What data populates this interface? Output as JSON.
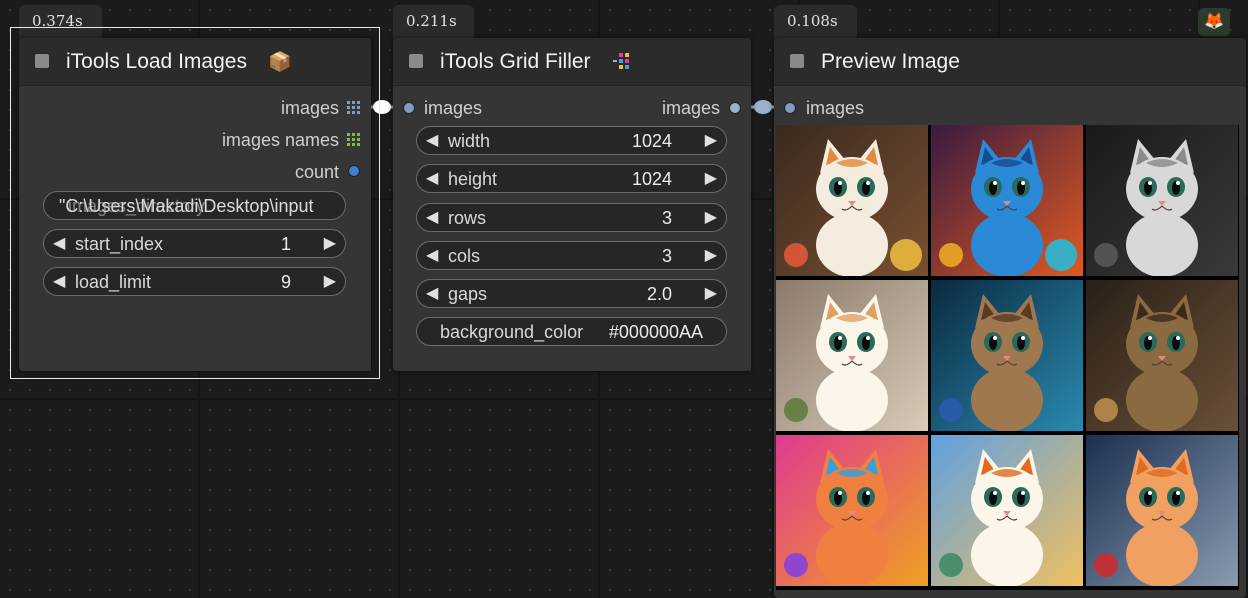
{
  "timings": {
    "load": "0.374s",
    "grid": "0.211s",
    "preview": "0.108s"
  },
  "load_node": {
    "title": "iTools Load Images",
    "title_icon": "📦",
    "outputs": [
      "images",
      "images names",
      "count"
    ],
    "path_value": "\"C:\\Users\\Makadi\\Desktop\\input",
    "path_overlay": "images_directory",
    "start_index": {
      "label": "start_index",
      "value": "1"
    },
    "load_limit": {
      "label": "load_limit",
      "value": "9"
    }
  },
  "grid_node": {
    "title": "iTools Grid Filler",
    "input": "images",
    "output": "images",
    "widgets": [
      {
        "label": "width",
        "value": "1024"
      },
      {
        "label": "height",
        "value": "1024"
      },
      {
        "label": "rows",
        "value": "3"
      },
      {
        "label": "cols",
        "value": "3"
      },
      {
        "label": "gaps",
        "value": "2.0"
      }
    ],
    "background_color": {
      "label": "background_color",
      "value": "#000000AA"
    }
  },
  "preview_node": {
    "title": "Preview Image",
    "input": "images"
  },
  "corner_icon": "fox-icon",
  "colors": {
    "canvas": "#1b1b1b",
    "node_body": "#353535",
    "node_title": "#2b2b2b",
    "slot_dot": "#7f9cc4",
    "link": "#9ab0cc",
    "count_dot": "#3f7fcf",
    "names_grid": "#7fbf3f"
  },
  "preview_cells": [
    "cat-toys-cell",
    "cat-blue-cubes-cell",
    "cat-grey-cell",
    "cat-sitting-cell",
    "cat-armor-cell",
    "cat-steampunk-cell",
    "cat-rainbow-cell",
    "cat-anime-cell",
    "cat-hero-cell"
  ]
}
